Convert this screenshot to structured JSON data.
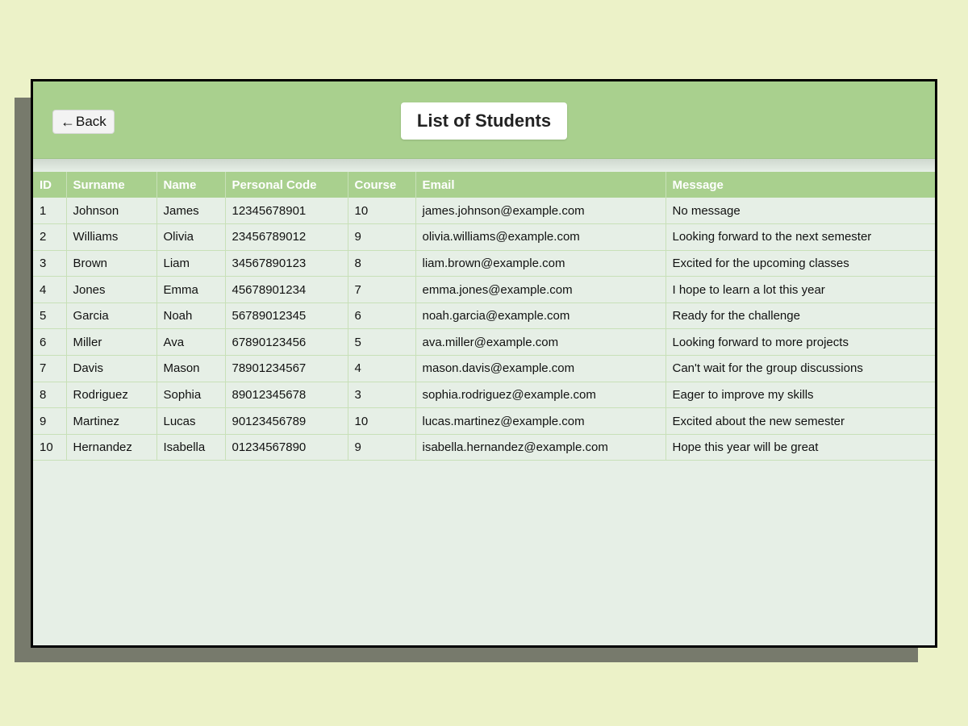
{
  "header": {
    "back_label": "Back",
    "back_icon": "left-arrow-icon",
    "title": "List of Students"
  },
  "table": {
    "columns": [
      "ID",
      "Surname",
      "Name",
      "Personal Code",
      "Course",
      "Email",
      "Message"
    ],
    "rows": [
      [
        "1",
        "Johnson",
        "James",
        "12345678901",
        "10",
        "james.johnson@example.com",
        "No message"
      ],
      [
        "2",
        "Williams",
        "Olivia",
        "23456789012",
        "9",
        "olivia.williams@example.com",
        "Looking forward to the next semester"
      ],
      [
        "3",
        "Brown",
        "Liam",
        "34567890123",
        "8",
        "liam.brown@example.com",
        "Excited for the upcoming classes"
      ],
      [
        "4",
        "Jones",
        "Emma",
        "45678901234",
        "7",
        "emma.jones@example.com",
        "I hope to learn a lot this year"
      ],
      [
        "5",
        "Garcia",
        "Noah",
        "56789012345",
        "6",
        "noah.garcia@example.com",
        "Ready for the challenge"
      ],
      [
        "6",
        "Miller",
        "Ava",
        "67890123456",
        "5",
        "ava.miller@example.com",
        "Looking forward to more projects"
      ],
      [
        "7",
        "Davis",
        "Mason",
        "78901234567",
        "4",
        "mason.davis@example.com",
        "Can't wait for the group discussions"
      ],
      [
        "8",
        "Rodriguez",
        "Sophia",
        "89012345678",
        "3",
        "sophia.rodriguez@example.com",
        "Eager to improve my skills"
      ],
      [
        "9",
        "Martinez",
        "Lucas",
        "90123456789",
        "10",
        "lucas.martinez@example.com",
        "Excited about the new semester"
      ],
      [
        "10",
        "Hernandez",
        "Isabella",
        "01234567890",
        "9",
        "isabella.hernandez@example.com",
        "Hope this year will be great"
      ]
    ]
  },
  "colors": {
    "page_background": "#ecf2c8",
    "header_green": "#a9d08e",
    "content_background": "#e6efe6",
    "header_text": "#ffffff"
  }
}
